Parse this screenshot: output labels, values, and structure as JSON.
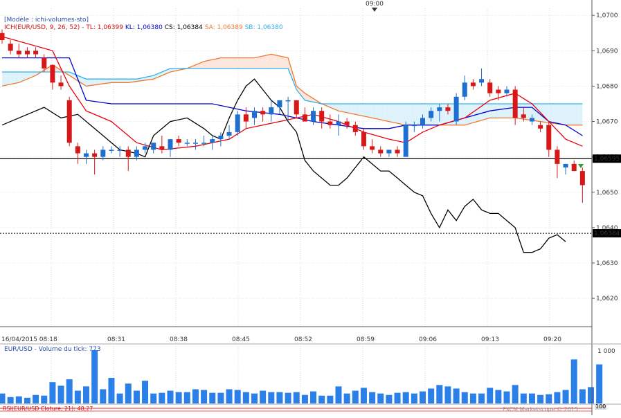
{
  "header": {
    "top_time": "09:00",
    "model": "[Modèle : ichi-volumes-sto]",
    "ich_prefix": "ICH(EUR/USD, 9, 26, 52) -",
    "tl": "TL: 1,06399",
    "kl": "KL: 1,06380",
    "cs": "CS: 1,06384",
    "sa": "SA: 1,06389",
    "sb": "SB: 1,06380"
  },
  "colors": {
    "tenkan": "#e8000b",
    "kijun": "#0000cc",
    "chikou": "#000000",
    "senkou_a": "#f07830",
    "senkou_b": "#30b0e8",
    "bull": "#1f6fd0",
    "bear": "#d81818",
    "volume": "#2a7fe8"
  },
  "price_panel": {
    "y_ticks": [
      "1,0700",
      "1,0690",
      "1,0680",
      "1,0670",
      "1,0660",
      "1,0650",
      "1,0640",
      "1,0630",
      "1,0620"
    ],
    "h_line_label": "1,06595",
    "dotted_line_label": "1,06384",
    "x_ticks": [
      "16/04/2015 08:18",
      "08:31",
      "08:38",
      "08:45",
      "08:52",
      "08:59",
      "09:06",
      "09:13",
      "09:20"
    ]
  },
  "volume_panel": {
    "title": "EUR/USD - Volume du tick: 773",
    "y_tick": "1 000"
  },
  "rsi_panel": {
    "label": "RSI(EUR/USD Cloture, 21): 48,27",
    "y_tick": "100"
  },
  "footer": "FXCM Marketscope © 2015",
  "chart_data": {
    "type": "candlestick",
    "ylim": [
      1.0612,
      1.0702
    ],
    "candles": [
      {
        "o": 1.0695,
        "h": 1.0696,
        "l": 1.0692,
        "c": 1.0693
      },
      {
        "o": 1.0692,
        "h": 1.0693,
        "l": 1.0689,
        "c": 1.069
      },
      {
        "o": 1.069,
        "h": 1.0692,
        "l": 1.0688,
        "c": 1.0689
      },
      {
        "o": 1.069,
        "h": 1.0691,
        "l": 1.0688,
        "c": 1.0689
      },
      {
        "o": 1.069,
        "h": 1.0691,
        "l": 1.0688,
        "c": 1.0689
      },
      {
        "o": 1.0688,
        "h": 1.0689,
        "l": 1.0684,
        "c": 1.0685
      },
      {
        "o": 1.0686,
        "h": 1.0686,
        "l": 1.0679,
        "c": 1.0681
      },
      {
        "o": 1.0681,
        "h": 1.0683,
        "l": 1.0679,
        "c": 1.068
      },
      {
        "o": 1.0676,
        "h": 1.0677,
        "l": 1.0663,
        "c": 1.0664
      },
      {
        "o": 1.0663,
        "h": 1.0664,
        "l": 1.0658,
        "c": 1.0661
      },
      {
        "o": 1.066,
        "h": 1.0662,
        "l": 1.0658,
        "c": 1.0661
      },
      {
        "o": 1.0661,
        "h": 1.0662,
        "l": 1.0655,
        "c": 1.066
      },
      {
        "o": 1.066,
        "h": 1.0663,
        "l": 1.0659,
        "c": 1.0662
      },
      {
        "o": 1.0662,
        "h": 1.0663,
        "l": 1.0661,
        "c": 1.0662
      },
      {
        "o": 1.0662,
        "h": 1.0663,
        "l": 1.066,
        "c": 1.0662
      },
      {
        "o": 1.0662,
        "h": 1.0663,
        "l": 1.0656,
        "c": 1.066
      },
      {
        "o": 1.066,
        "h": 1.0663,
        "l": 1.0659,
        "c": 1.0662
      },
      {
        "o": 1.0662,
        "h": 1.0664,
        "l": 1.0661,
        "c": 1.0663
      },
      {
        "o": 1.0662,
        "h": 1.0664,
        "l": 1.0661,
        "c": 1.0664
      },
      {
        "o": 1.0663,
        "h": 1.0666,
        "l": 1.0661,
        "c": 1.0662
      },
      {
        "o": 1.0662,
        "h": 1.0665,
        "l": 1.066,
        "c": 1.0665
      },
      {
        "o": 1.0665,
        "h": 1.0666,
        "l": 1.0663,
        "c": 1.0664
      },
      {
        "o": 1.0664,
        "h": 1.0665,
        "l": 1.0663,
        "c": 1.0664
      },
      {
        "o": 1.0664,
        "h": 1.0665,
        "l": 1.0662,
        "c": 1.0664
      },
      {
        "o": 1.0664,
        "h": 1.0666,
        "l": 1.0663,
        "c": 1.0664
      },
      {
        "o": 1.0664,
        "h": 1.0666,
        "l": 1.0662,
        "c": 1.0665
      },
      {
        "o": 1.0665,
        "h": 1.0667,
        "l": 1.0663,
        "c": 1.0666
      },
      {
        "o": 1.0666,
        "h": 1.0669,
        "l": 1.0665,
        "c": 1.0667
      },
      {
        "o": 1.0667,
        "h": 1.0673,
        "l": 1.0666,
        "c": 1.0672
      },
      {
        "o": 1.0672,
        "h": 1.0674,
        "l": 1.0668,
        "c": 1.067
      },
      {
        "o": 1.0671,
        "h": 1.0674,
        "l": 1.0669,
        "c": 1.0673
      },
      {
        "o": 1.0673,
        "h": 1.0674,
        "l": 1.067,
        "c": 1.0672
      },
      {
        "o": 1.0672,
        "h": 1.0676,
        "l": 1.067,
        "c": 1.0674
      },
      {
        "o": 1.0674,
        "h": 1.0675,
        "l": 1.0672,
        "c": 1.0676
      },
      {
        "o": 1.0676,
        "h": 1.0677,
        "l": 1.067,
        "c": 1.0676
      },
      {
        "o": 1.0676,
        "h": 1.0676,
        "l": 1.0671,
        "c": 1.0672
      },
      {
        "o": 1.0672,
        "h": 1.0674,
        "l": 1.067,
        "c": 1.067
      },
      {
        "o": 1.067,
        "h": 1.0674,
        "l": 1.0669,
        "c": 1.0673
      },
      {
        "o": 1.0673,
        "h": 1.0674,
        "l": 1.0668,
        "c": 1.067
      },
      {
        "o": 1.067,
        "h": 1.0672,
        "l": 1.0668,
        "c": 1.0669
      },
      {
        "o": 1.0669,
        "h": 1.0672,
        "l": 1.0666,
        "c": 1.067
      },
      {
        "o": 1.067,
        "h": 1.0671,
        "l": 1.0668,
        "c": 1.0669
      },
      {
        "o": 1.0669,
        "h": 1.067,
        "l": 1.0666,
        "c": 1.0667
      },
      {
        "o": 1.0667,
        "h": 1.0668,
        "l": 1.0662,
        "c": 1.0663
      },
      {
        "o": 1.0663,
        "h": 1.0665,
        "l": 1.0661,
        "c": 1.0662
      },
      {
        "o": 1.0662,
        "h": 1.0663,
        "l": 1.066,
        "c": 1.0661
      },
      {
        "o": 1.0661,
        "h": 1.0662,
        "l": 1.066,
        "c": 1.0662
      },
      {
        "o": 1.0662,
        "h": 1.0663,
        "l": 1.066,
        "c": 1.0661
      },
      {
        "o": 1.066,
        "h": 1.067,
        "l": 1.066,
        "c": 1.0669
      },
      {
        "o": 1.0669,
        "h": 1.067,
        "l": 1.0667,
        "c": 1.0669
      },
      {
        "o": 1.0669,
        "h": 1.0672,
        "l": 1.0668,
        "c": 1.0671
      },
      {
        "o": 1.0671,
        "h": 1.0674,
        "l": 1.067,
        "c": 1.0673
      },
      {
        "o": 1.0673,
        "h": 1.0675,
        "l": 1.067,
        "c": 1.0674
      },
      {
        "o": 1.0674,
        "h": 1.0675,
        "l": 1.0672,
        "c": 1.0673
      },
      {
        "o": 1.067,
        "h": 1.0678,
        "l": 1.0669,
        "c": 1.0677
      },
      {
        "o": 1.0677,
        "h": 1.0683,
        "l": 1.0676,
        "c": 1.0681
      },
      {
        "o": 1.0681,
        "h": 1.0682,
        "l": 1.0679,
        "c": 1.068
      },
      {
        "o": 1.0681,
        "h": 1.0685,
        "l": 1.068,
        "c": 1.0682
      },
      {
        "o": 1.0681,
        "h": 1.0682,
        "l": 1.0677,
        "c": 1.0678
      },
      {
        "o": 1.0679,
        "h": 1.068,
        "l": 1.0676,
        "c": 1.0678
      },
      {
        "o": 1.0678,
        "h": 1.068,
        "l": 1.0677,
        "c": 1.0679
      },
      {
        "o": 1.0679,
        "h": 1.068,
        "l": 1.0669,
        "c": 1.0671
      },
      {
        "o": 1.0672,
        "h": 1.0674,
        "l": 1.067,
        "c": 1.0671
      },
      {
        "o": 1.067,
        "h": 1.0672,
        "l": 1.0669,
        "c": 1.0671
      },
      {
        "o": 1.0669,
        "h": 1.067,
        "l": 1.0667,
        "c": 1.0668
      },
      {
        "o": 1.0669,
        "h": 1.067,
        "l": 1.066,
        "c": 1.0662
      },
      {
        "o": 1.0662,
        "h": 1.0663,
        "l": 1.0654,
        "c": 1.0658
      },
      {
        "o": 1.0657,
        "h": 1.0658,
        "l": 1.0655,
        "c": 1.0658
      },
      {
        "o": 1.0658,
        "h": 1.0659,
        "l": 1.0656,
        "c": 1.0656
      },
      {
        "o": 1.0656,
        "h": 1.0657,
        "l": 1.0647,
        "c": 1.0652
      }
    ],
    "tenkan": [
      [
        0,
        1.0694
      ],
      [
        6,
        1.069
      ],
      [
        8,
        1.068
      ],
      [
        10,
        1.0673
      ],
      [
        13,
        1.067
      ],
      [
        16,
        1.0664
      ],
      [
        19,
        1.0662
      ],
      [
        23,
        1.0663
      ],
      [
        27,
        1.0665
      ],
      [
        29,
        1.0668
      ],
      [
        33,
        1.067
      ],
      [
        37,
        1.0672
      ],
      [
        40,
        1.067
      ],
      [
        43,
        1.0667
      ],
      [
        46,
        1.0665
      ],
      [
        48,
        1.0664
      ],
      [
        50,
        1.0667
      ],
      [
        52,
        1.0669
      ],
      [
        55,
        1.0671
      ],
      [
        58,
        1.0676
      ],
      [
        61,
        1.0678
      ],
      [
        63,
        1.0675
      ],
      [
        65,
        1.067
      ],
      [
        67,
        1.0665
      ],
      [
        69,
        1.0663
      ]
    ],
    "kijun": [
      [
        0,
        1.0688
      ],
      [
        4,
        1.0688
      ],
      [
        8,
        1.0688
      ],
      [
        10,
        1.0676
      ],
      [
        13,
        1.0675
      ],
      [
        20,
        1.0675
      ],
      [
        25,
        1.0675
      ],
      [
        29,
        1.0673
      ],
      [
        33,
        1.0672
      ],
      [
        37,
        1.067
      ],
      [
        40,
        1.0669
      ],
      [
        43,
        1.0668
      ],
      [
        46,
        1.0668
      ],
      [
        48,
        1.0669
      ],
      [
        50,
        1.0669
      ],
      [
        52,
        1.0669
      ],
      [
        55,
        1.0671
      ],
      [
        58,
        1.0673
      ],
      [
        61,
        1.0674
      ],
      [
        63,
        1.0674
      ],
      [
        65,
        1.067
      ],
      [
        67,
        1.0669
      ],
      [
        69,
        1.0666
      ]
    ],
    "chikou": [
      [
        0,
        1.0669
      ],
      [
        3,
        1.0672
      ],
      [
        5,
        1.0674
      ],
      [
        7,
        1.0671
      ],
      [
        9,
        1.0672
      ],
      [
        11,
        1.0668
      ],
      [
        13,
        1.0664
      ],
      [
        14,
        1.0662
      ],
      [
        16,
        1.0661
      ],
      [
        17,
        1.066
      ],
      [
        18,
        1.0666
      ],
      [
        20,
        1.067
      ],
      [
        22,
        1.0671
      ],
      [
        24,
        1.0668
      ],
      [
        25,
        1.0666
      ],
      [
        26,
        1.0665
      ],
      [
        27,
        1.0671
      ],
      [
        28,
        1.0676
      ],
      [
        29,
        1.068
      ],
      [
        30,
        1.0682
      ],
      [
        31,
        1.0679
      ],
      [
        32,
        1.0676
      ],
      [
        33,
        1.0674
      ],
      [
        34,
        1.067
      ],
      [
        35,
        1.0667
      ],
      [
        36,
        1.0659
      ],
      [
        37,
        1.0656
      ],
      [
        38,
        1.0654
      ],
      [
        39,
        1.0652
      ],
      [
        40,
        1.0652
      ],
      [
        41,
        1.0654
      ],
      [
        42,
        1.0657
      ],
      [
        43,
        1.066
      ],
      [
        44,
        1.0658
      ],
      [
        45,
        1.0656
      ],
      [
        46,
        1.0656
      ],
      [
        47,
        1.0654
      ],
      [
        48,
        1.0652
      ],
      [
        49,
        1.065
      ],
      [
        50,
        1.0649
      ],
      [
        51,
        1.0644
      ],
      [
        52,
        1.064
      ],
      [
        53,
        1.0645
      ],
      [
        54,
        1.0642
      ],
      [
        55,
        1.0646
      ],
      [
        56,
        1.0648
      ],
      [
        57,
        1.0645
      ],
      [
        58,
        1.0644
      ],
      [
        59,
        1.0644
      ],
      [
        60,
        1.0642
      ],
      [
        61,
        1.064
      ],
      [
        62,
        1.0633
      ],
      [
        63,
        1.0633
      ],
      [
        64,
        1.0634
      ],
      [
        65,
        1.0637
      ],
      [
        66,
        1.0638
      ],
      [
        67,
        1.0636
      ]
    ],
    "senkou_a": [
      [
        0,
        1.068
      ],
      [
        2,
        1.0681
      ],
      [
        4,
        1.0683
      ],
      [
        6,
        1.0686
      ],
      [
        8,
        1.0683
      ],
      [
        10,
        1.068
      ],
      [
        13,
        1.0681
      ],
      [
        15,
        1.0681
      ],
      [
        18,
        1.0682
      ],
      [
        20,
        1.0684
      ],
      [
        22,
        1.0685
      ],
      [
        24,
        1.0687
      ],
      [
        26,
        1.0688
      ],
      [
        28,
        1.0688
      ],
      [
        30,
        1.0688
      ],
      [
        32,
        1.0689
      ],
      [
        34,
        1.0688
      ],
      [
        35,
        1.068
      ],
      [
        36,
        1.0678
      ],
      [
        38,
        1.0675
      ],
      [
        40,
        1.0673
      ],
      [
        42,
        1.0672
      ],
      [
        44,
        1.0671
      ],
      [
        46,
        1.067
      ],
      [
        48,
        1.0669
      ],
      [
        50,
        1.0669
      ],
      [
        52,
        1.0669
      ],
      [
        55,
        1.0669
      ],
      [
        58,
        1.0671
      ],
      [
        61,
        1.0671
      ],
      [
        64,
        1.067
      ],
      [
        67,
        1.0669
      ],
      [
        69,
        1.0669
      ]
    ],
    "senkou_b": [
      [
        0,
        1.0684
      ],
      [
        4,
        1.0684
      ],
      [
        8,
        1.0684
      ],
      [
        10,
        1.0682
      ],
      [
        14,
        1.0682
      ],
      [
        16,
        1.0682
      ],
      [
        18,
        1.0683
      ],
      [
        20,
        1.0685
      ],
      [
        22,
        1.0685
      ],
      [
        34,
        1.0685
      ],
      [
        35,
        1.0679
      ],
      [
        36,
        1.0676
      ],
      [
        38,
        1.0675
      ],
      [
        69,
        1.0675
      ]
    ],
    "volume": [
      14,
      9,
      10,
      8,
      12,
      11,
      30,
      25,
      34,
      18,
      24,
      75,
      20,
      36,
      14,
      28,
      18,
      32,
      14,
      15,
      18,
      16,
      16,
      20,
      19,
      15,
      15,
      20,
      19,
      16,
      14,
      18,
      16,
      16,
      15,
      16,
      12,
      17,
      11,
      11,
      24,
      14,
      18,
      22,
      16,
      14,
      12,
      15,
      16,
      14,
      17,
      21,
      26,
      24,
      21,
      16,
      14,
      14,
      22,
      19,
      17,
      26,
      14,
      14,
      12,
      13,
      16,
      19,
      62,
      20,
      23,
      55
    ]
  }
}
